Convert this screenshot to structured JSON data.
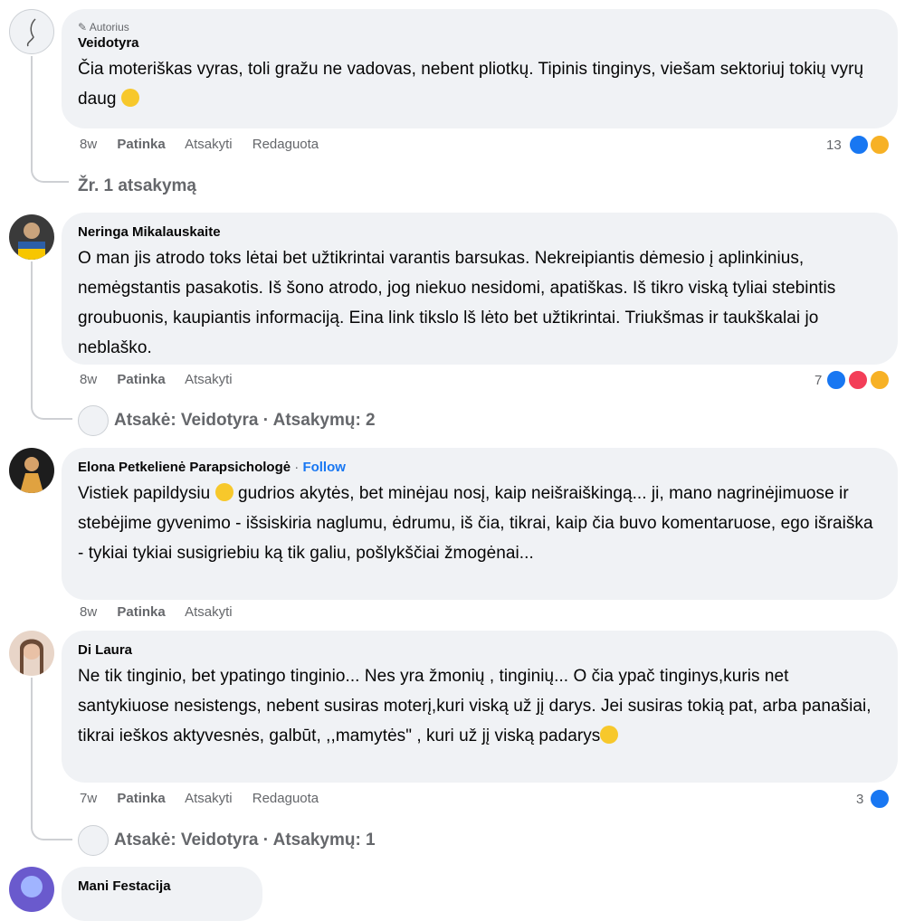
{
  "comments": [
    {
      "badge": "Autorius",
      "name": "Veidotyra",
      "text": "Čia moteriškas vyras, toli gražu ne vadovas, nebent pliotkų. Tipinis tinginys, viešam sektoriuj tokių vyrų daug",
      "time": "8w",
      "like": "Patinka",
      "reply": "Atsakyti",
      "edit": "Redaguota",
      "reactions": "13",
      "replies_link": "Žr. 1 atsakymą"
    },
    {
      "name": "Neringa Mikalauskaite",
      "text": "O man jis atrodo toks lėtai bet užtikrintai varantis barsukas. Nekreipiantis dėmesio į aplinkinius, nemėgstantis pasakotis. Iš šono atrodo, jog niekuo nesidomi, apatiškas. Iš tikro viską tyliai stebintis groubuonis, kaupiantis informaciją. Eina link tikslo lš lėto bet užtikrintai. Triukšmas ir taukškalai jo neblaško.",
      "time": "8w",
      "like": "Patinka",
      "reply": "Atsakyti",
      "reactions": "7",
      "replies_link": "Atsakė: Veidotyra · Atsakymų: 2"
    },
    {
      "name": "Elona Petkelienė Parapsichologė",
      "separator": " · ",
      "follow": "Follow",
      "text_before": "Vistiek papildysiu",
      "text_after": " gudrios akytės, bet minėjau nosį, kaip neišraiškingą... ji, mano nagrinėjimuose ir stebėjime gyvenimo - išsiskiria naglumu, ėdrumu, iš čia, tikrai, kaip čia buvo komentaruose, ego išraiška - tykiai tykiai susigriebiu ką tik galiu, pošlykščiai žmogėnai...",
      "time": "8w",
      "like": "Patinka",
      "reply": "Atsakyti"
    },
    {
      "name": "Di Laura",
      "text": "Ne tik tinginio, bet ypatingo tinginio... Nes yra žmonių , tinginių... O čia ypač tinginys,kuris net santykiuose nesistengs, nebent susiras moterį,kuri viską už jį darys. Jei susiras tokią pat, arba panašiai, tikrai ieškos aktyvesnės, galbūt, ,,mamytės\" , kuri už jį viską padarys",
      "time": "7w",
      "like": "Patinka",
      "reply": "Atsakyti",
      "edit": "Redaguota",
      "reactions": "3",
      "replies_link": "Atsakė: Veidotyra · Atsakymų: 1"
    },
    {
      "name": "Mani Festacija"
    }
  ],
  "colors": {
    "bubble": "#f0f2f5",
    "meta": "#65676b",
    "link": "#1877f2"
  }
}
